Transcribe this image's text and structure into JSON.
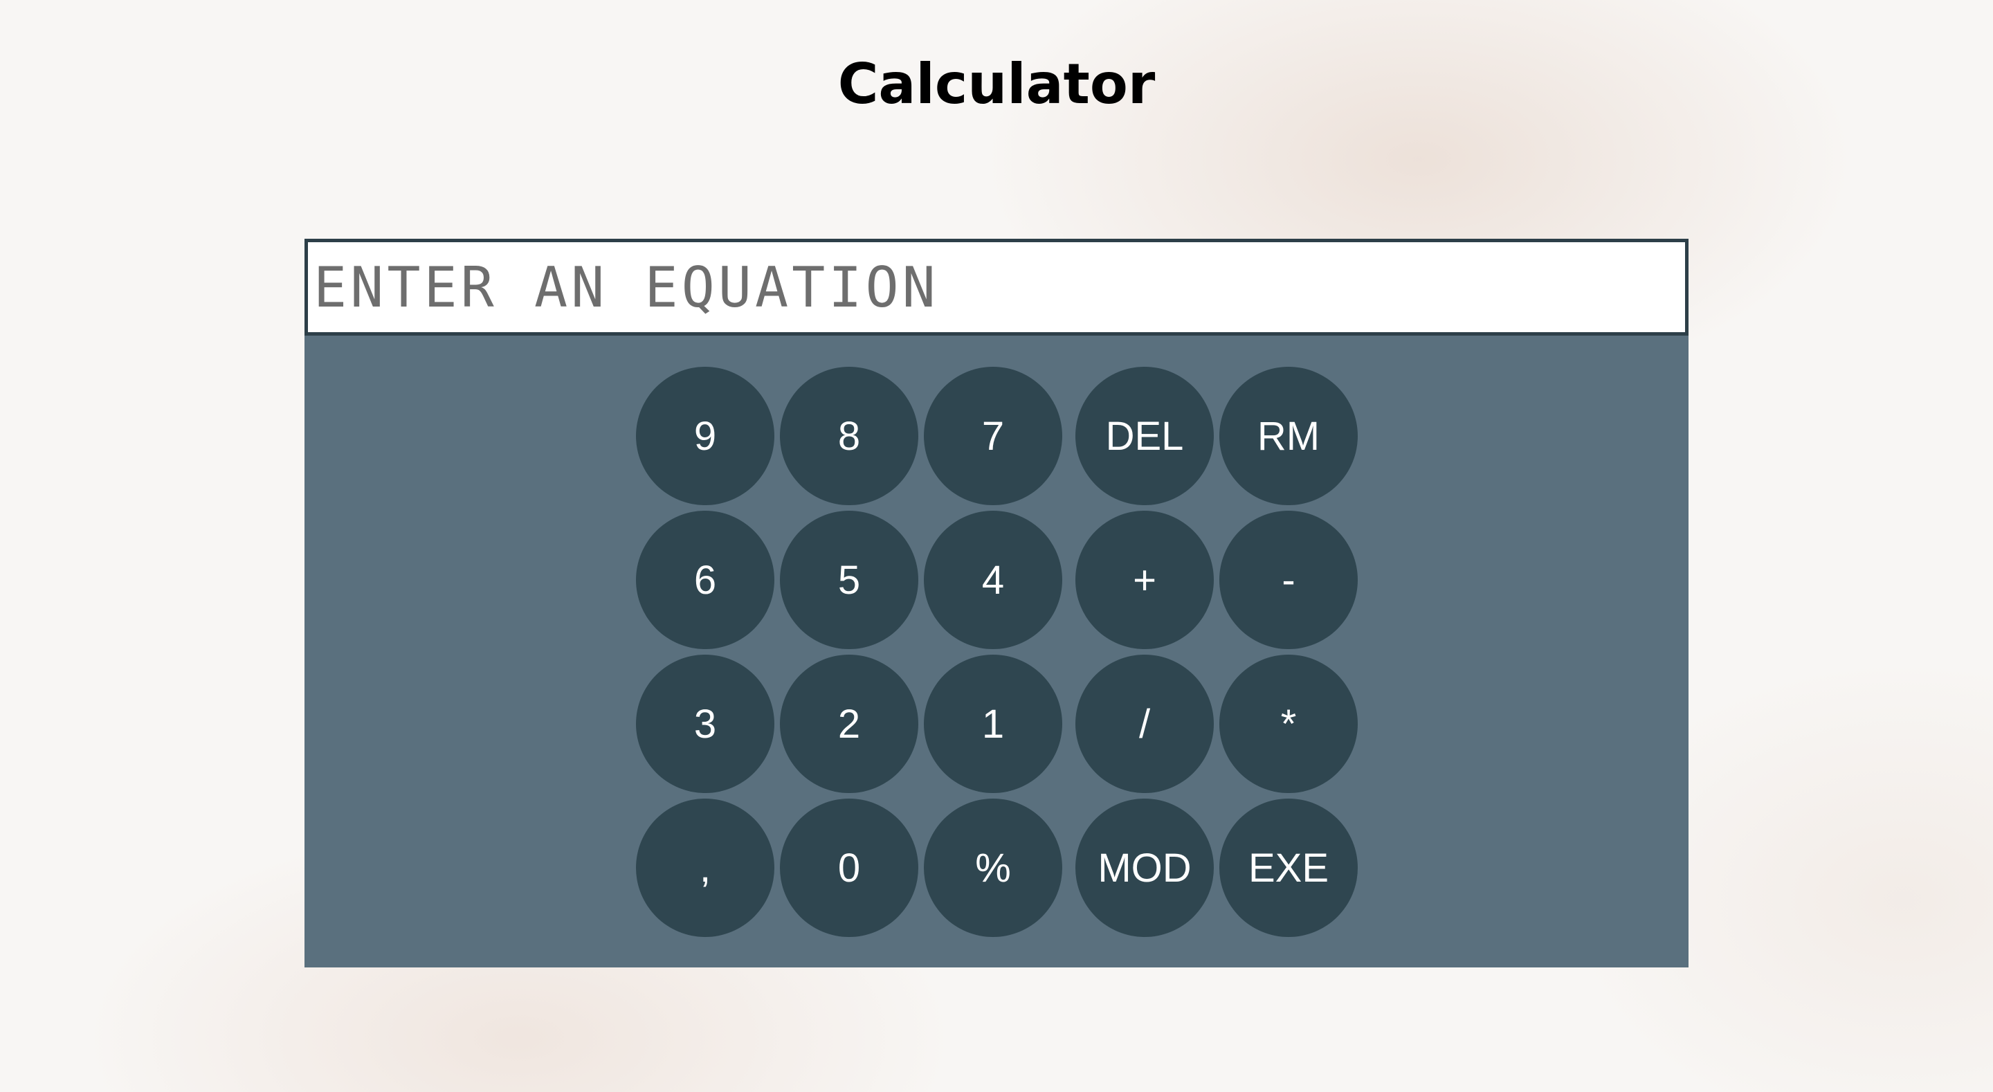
{
  "page": {
    "title": "Calculator"
  },
  "display": {
    "placeholder": "ENTER AN EQUATION",
    "value": ""
  },
  "keypad": {
    "rows": [
      [
        "9",
        "8",
        "7",
        "DEL",
        "RM"
      ],
      [
        "6",
        "5",
        "4",
        "+",
        "-"
      ],
      [
        "3",
        "2",
        "1",
        "/",
        "*"
      ],
      [
        ",",
        "0",
        "%",
        "MOD",
        "EXE"
      ]
    ]
  },
  "colors": {
    "panel": "#5a707e",
    "key": "#2f4650",
    "key_text": "#ffffff",
    "display_border": "#2d3f48"
  }
}
